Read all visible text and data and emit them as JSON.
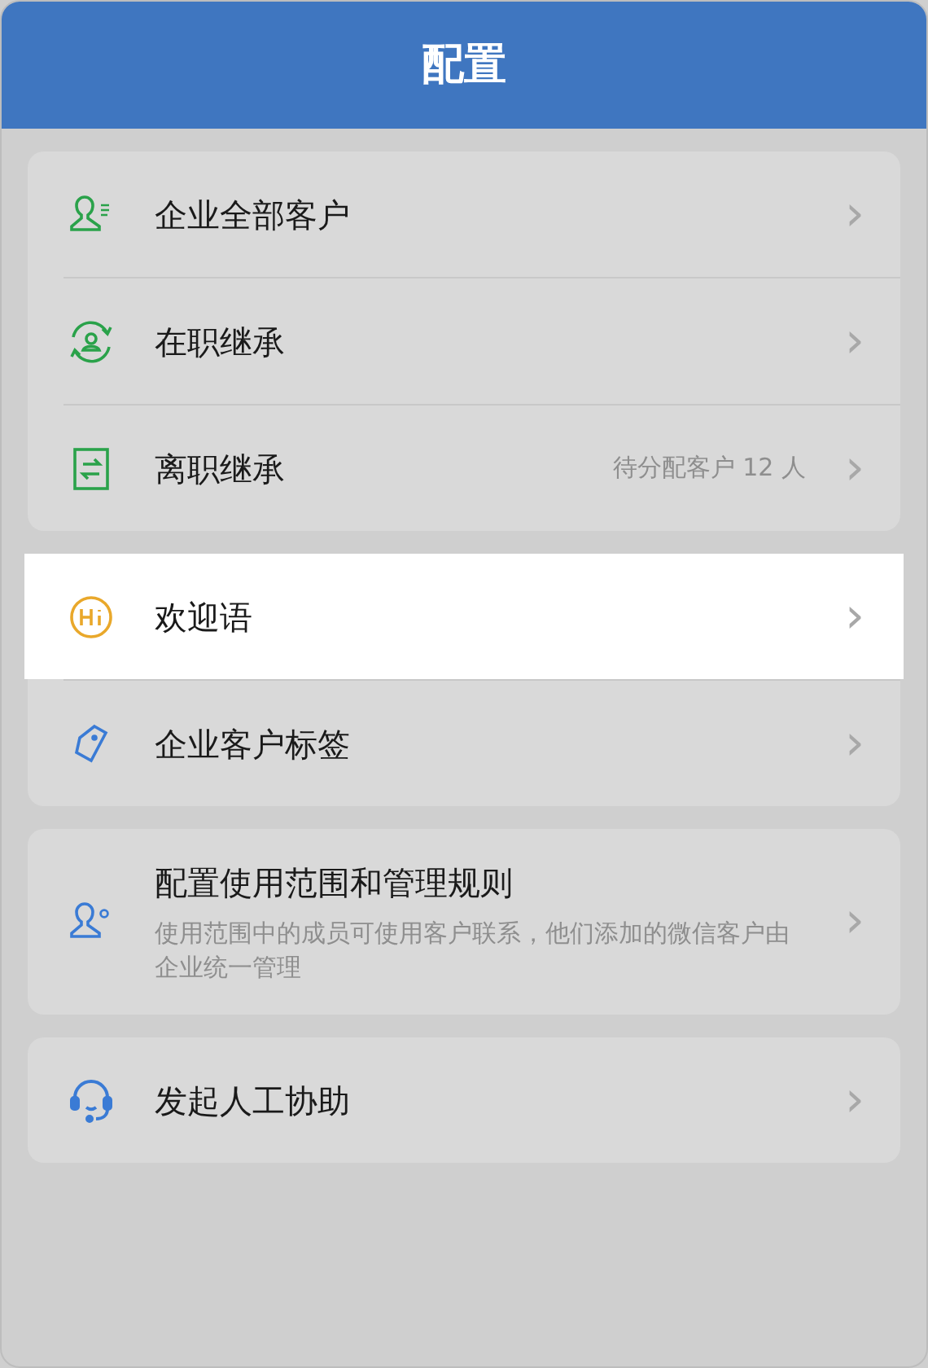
{
  "header": {
    "title": "配置"
  },
  "groups": [
    {
      "items": [
        {
          "label": "企业全部客户",
          "selected": false
        },
        {
          "label": "在职继承",
          "selected": false
        },
        {
          "label": "离职继承",
          "note": "待分配客户 12 人",
          "selected": false
        }
      ]
    },
    {
      "items": [
        {
          "label": "欢迎语",
          "selected": true
        },
        {
          "label": "企业客户标签",
          "selected": false
        }
      ]
    },
    {
      "items": [
        {
          "label": "配置使用范围和管理规则",
          "description": "使用范围中的成员可使用客户联系，他们添加的微信客户由企业统一管理",
          "selected": false
        }
      ]
    },
    {
      "items": [
        {
          "label": "发起人工协助",
          "selected": false
        }
      ]
    }
  ],
  "chevron": "›"
}
